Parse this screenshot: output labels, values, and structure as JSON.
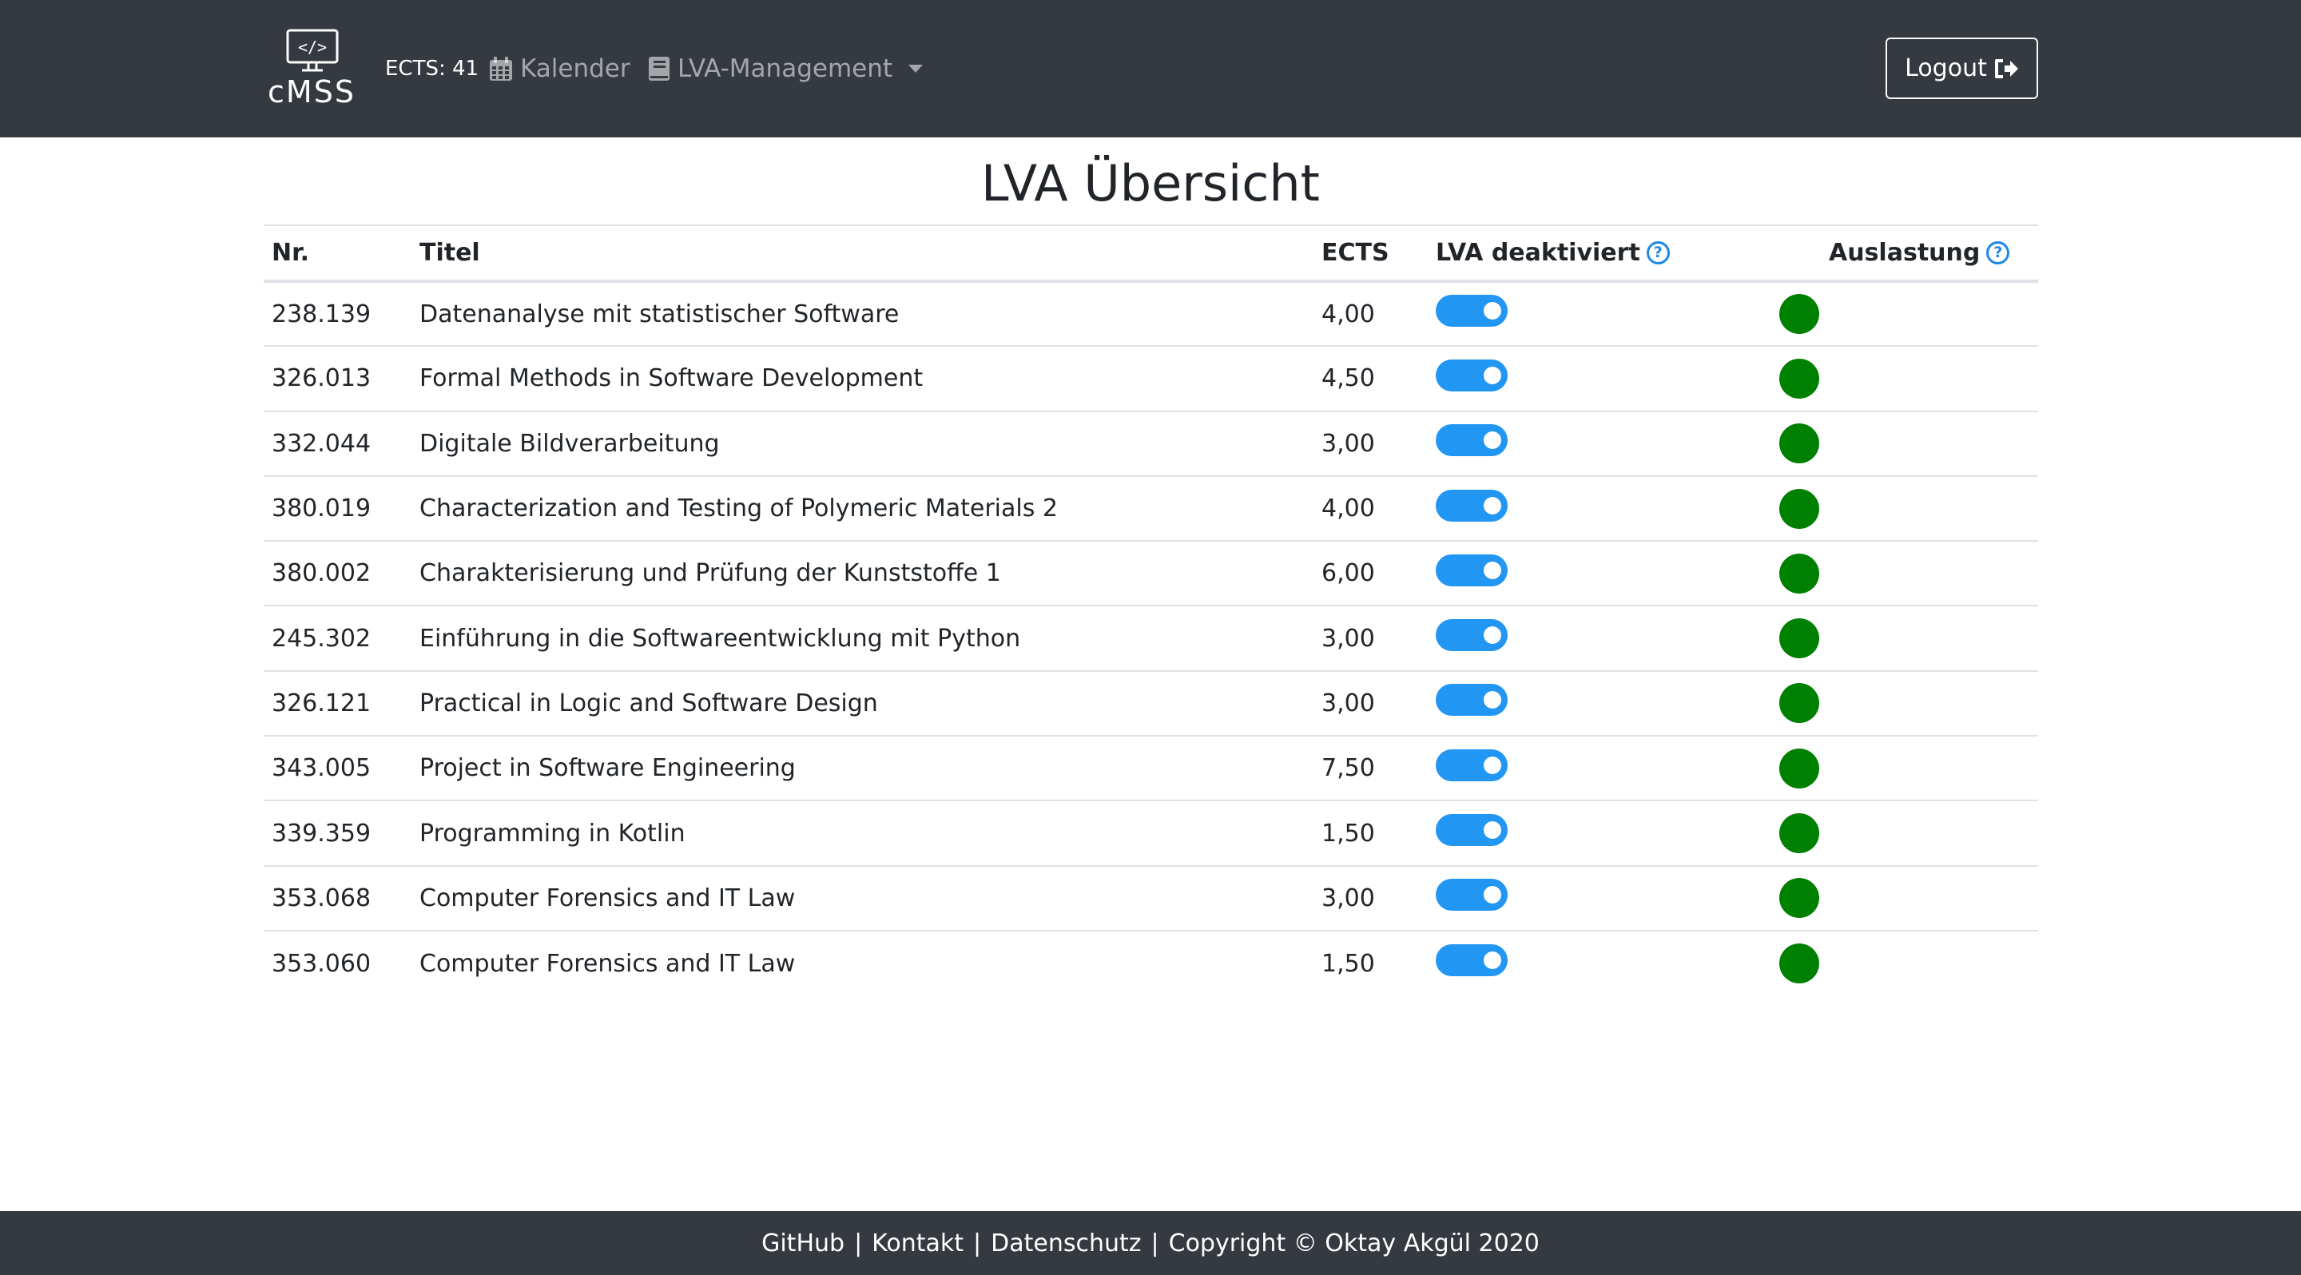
{
  "nav": {
    "logo_text": "cMSS",
    "ects_label": "ECTS: 41",
    "kalender": "Kalender",
    "lva_management": "LVA-Management",
    "logout": "Logout"
  },
  "page": {
    "title": "LVA Übersicht"
  },
  "table": {
    "headers": {
      "nr": "Nr.",
      "titel": "Titel",
      "ects": "ECTS",
      "deaktiviert": "LVA deaktiviert",
      "auslastung": "Auslastung"
    },
    "rows": [
      {
        "nr": "238.139",
        "titel": "Datenanalyse mit statistischer Software",
        "ects": "4,00",
        "deaktiviert": true,
        "auslastung": "green"
      },
      {
        "nr": "326.013",
        "titel": "Formal Methods in Software Development",
        "ects": "4,50",
        "deaktiviert": true,
        "auslastung": "green"
      },
      {
        "nr": "332.044",
        "titel": "Digitale Bildverarbeitung",
        "ects": "3,00",
        "deaktiviert": true,
        "auslastung": "green"
      },
      {
        "nr": "380.019",
        "titel": "Characterization and Testing of Polymeric Materials 2",
        "ects": "4,00",
        "deaktiviert": true,
        "auslastung": "green"
      },
      {
        "nr": "380.002",
        "titel": "Charakterisierung und Prüfung der Kunststoffe 1",
        "ects": "6,00",
        "deaktiviert": true,
        "auslastung": "green"
      },
      {
        "nr": "245.302",
        "titel": "Einführung in die Softwareentwicklung mit Python",
        "ects": "3,00",
        "deaktiviert": true,
        "auslastung": "green"
      },
      {
        "nr": "326.121",
        "titel": "Practical in Logic and Software Design",
        "ects": "3,00",
        "deaktiviert": true,
        "auslastung": "green"
      },
      {
        "nr": "343.005",
        "titel": "Project in Software Engineering",
        "ects": "7,50",
        "deaktiviert": true,
        "auslastung": "green"
      },
      {
        "nr": "339.359",
        "titel": "Programming in Kotlin",
        "ects": "1,50",
        "deaktiviert": true,
        "auslastung": "green"
      },
      {
        "nr": "353.068",
        "titel": "Computer Forensics and IT Law",
        "ects": "3,00",
        "deaktiviert": true,
        "auslastung": "green"
      },
      {
        "nr": "353.060",
        "titel": "Computer Forensics and IT Law",
        "ects": "1,50",
        "deaktiviert": true,
        "auslastung": "green"
      }
    ]
  },
  "footer": {
    "github": "GitHub",
    "kontakt": "Kontakt",
    "datenschutz": "Datenschutz",
    "copyright": "Copyright © Oktay Akgül 2020",
    "separator": "|"
  },
  "colors": {
    "navbar": "#343a40",
    "toggle_on": "#2196f3",
    "status_green": "#008000",
    "help_blue": "#1e88e5"
  }
}
